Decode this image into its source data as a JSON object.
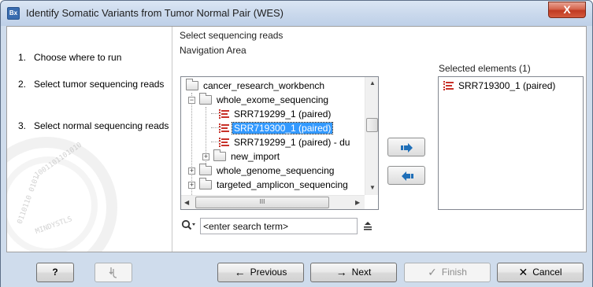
{
  "window": {
    "title": "Identify Somatic Variants from Tumor Normal Pair (WES)",
    "app_icon": "Bx",
    "close_glyph": "X"
  },
  "steps": [
    {
      "num": "1.",
      "label": "Choose where to run"
    },
    {
      "num": "2.",
      "label": "Select tumor sequencing reads"
    },
    {
      "num": "3.",
      "label": "Select normal sequencing reads"
    }
  ],
  "panel": {
    "group_label": "Select sequencing reads",
    "nav_label": "Navigation Area",
    "selected_label": "Selected elements (1)"
  },
  "tree": {
    "items": [
      {
        "label": "cancer_research_workbench",
        "type": "folder"
      },
      {
        "label": "whole_exome_sequencing",
        "type": "folder"
      },
      {
        "label": "SRR719299_1 (paired)",
        "type": "reads"
      },
      {
        "label": "SRR719300_1 (paired)",
        "type": "reads",
        "selected": true
      },
      {
        "label": "SRR719299_1 (paired) - du",
        "type": "reads"
      },
      {
        "label": "new_import",
        "type": "folder"
      },
      {
        "label": "whole_genome_sequencing",
        "type": "folder"
      },
      {
        "label": "targeted_amplicon_sequencing",
        "type": "folder"
      }
    ],
    "hscroll_grip": "III"
  },
  "selected_elements": [
    {
      "label": "SRR719300_1 (paired)"
    }
  ],
  "search": {
    "placeholder": "<enter search term>",
    "value": "<enter search term>"
  },
  "buttons": {
    "help": "?",
    "previous": "Previous",
    "next": "Next",
    "finish": "Finish",
    "cancel": "Cancel"
  },
  "watermark_lines": [
    "1001101101010",
    "0110110 0101",
    "MINDYSTLS"
  ],
  "colors": {
    "accent": "#3399ff",
    "reads_icon": "#c8322a",
    "move_arrow": "#1f6fb8",
    "window_frame": "#cfdcec"
  }
}
